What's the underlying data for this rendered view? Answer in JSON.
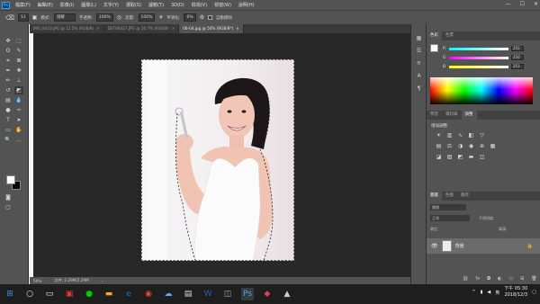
{
  "app": {
    "logo": "Ps"
  },
  "menu": [
    "檔案(F)",
    "編輯(E)",
    "影像(I)",
    "圖層(L)",
    "文字(Y)",
    "選取(S)",
    "濾鏡(T)",
    "3D(D)",
    "檢視(V)",
    "視窗(W)",
    "說明(H)"
  ],
  "window_controls": {
    "minimize": "—",
    "maximize": "☐",
    "close": "✕"
  },
  "options": {
    "mode_label": "模式:",
    "mode_value": "溶解",
    "opacity_label": "不透明:",
    "opacity_value": "100%",
    "flow_label": "流量:",
    "flow_value": "100%",
    "smoothing_label": "平滑化:",
    "smoothing_value": "0%",
    "auto_erase_label": "自動擦除",
    "brush_size": "11"
  },
  "tabs": [
    {
      "label": "IMG_8453.JPG @ 12.5% (RGB/8)",
      "close": "×"
    },
    {
      "label": "DSTV6427.JPG @ 16.7% (RGB/8)",
      "close": "×"
    },
    {
      "label": "06-04.jpg @ 50% (RGB/8*)",
      "close": "×"
    }
  ],
  "status": {
    "zoom": "50%",
    "doc": "文件: 2.29M/2.29M",
    "arrow": "›"
  },
  "color_panel": {
    "tabs": [
      "色彩",
      "色票"
    ],
    "r": {
      "letter": "R",
      "value": "255"
    },
    "g": {
      "letter": "G",
      "value": "250"
    },
    "b": {
      "letter": "B",
      "value": "251"
    }
  },
  "adjust_panel": {
    "tabs": [
      "學習",
      "資料庫",
      "調整"
    ],
    "title": "增加調整"
  },
  "layers_panel": {
    "tabs": [
      "圖層",
      "色版",
      "路徑"
    ],
    "kind_label": "種類",
    "blend_mode": "正常",
    "opacity_label": "不透明度:",
    "fill_label": "填滿:",
    "lock_label": "鎖定:",
    "layer_name": "背景"
  },
  "taskbar": {
    "time": "下午 05:30",
    "date": "2018/12/3",
    "lang": "英"
  },
  "colors": {
    "accent": "#31a8ff",
    "panel": "#535353",
    "dark": "#282828"
  }
}
